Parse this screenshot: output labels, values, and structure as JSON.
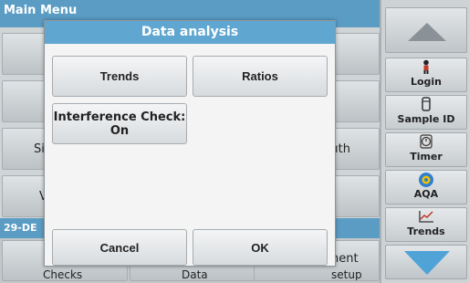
{
  "background": {
    "title": "Main Menu",
    "row_labels": [
      "Si",
      "ıth",
      "V"
    ],
    "date_partial": "29-DE",
    "bottom_fragments": [
      "Checks",
      "Data",
      "nent",
      "setup"
    ]
  },
  "sidebar": {
    "up_icon": "triangle-up-icon",
    "down_icon": "triangle-down-icon",
    "buttons": [
      {
        "label": "Login",
        "icon": "person-icon",
        "glyph": "🯅"
      },
      {
        "label": "Sample ID",
        "icon": "vial-icon",
        "glyph": "▯"
      },
      {
        "label": "Timer",
        "icon": "timer-icon",
        "glyph": "⌚"
      },
      {
        "label": "AQA",
        "icon": "aqa-icon",
        "glyph": "◉"
      },
      {
        "label": "Trends",
        "icon": "trends-icon",
        "glyph": "⟋"
      }
    ]
  },
  "dialog": {
    "title": "Data analysis",
    "buttons": {
      "trends": "Trends",
      "ratios": "Ratios",
      "interference_line1": "Interference Check:",
      "interference_line2": "On",
      "cancel": "Cancel",
      "ok": "OK"
    }
  },
  "colors": {
    "header_blue": "#5b9cc4",
    "dialog_title_blue": "#5fa6d0",
    "arrow_blue": "#5fa6d0"
  }
}
